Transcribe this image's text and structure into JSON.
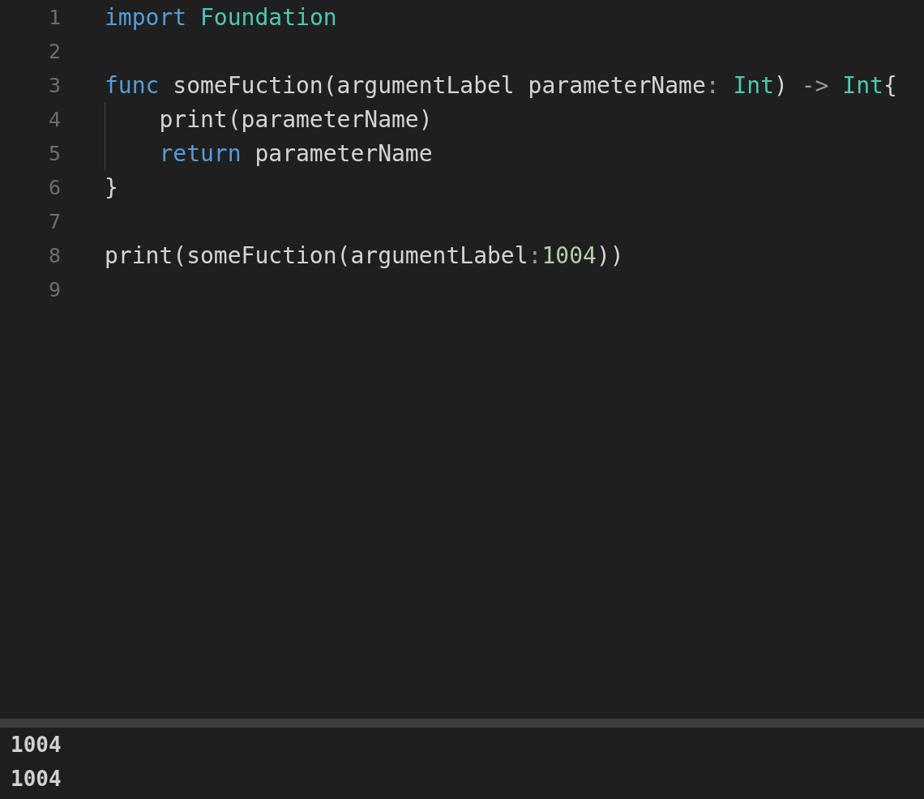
{
  "editor": {
    "lines": [
      {
        "number": "1",
        "indent_guide": false,
        "tokens": [
          {
            "text": "import ",
            "kind": "keyword"
          },
          {
            "text": "Foundation",
            "kind": "type"
          }
        ]
      },
      {
        "number": "2",
        "indent_guide": false
      },
      {
        "number": "3",
        "indent_guide": false,
        "tokens": [
          {
            "text": "func",
            "kind": "keyword"
          },
          {
            "text": " someFuction(argumentLabel parameterName",
            "kind": "plain"
          },
          {
            "text": ":",
            "kind": "operator"
          },
          {
            "text": " Int",
            "kind": "type"
          },
          {
            "text": ") ",
            "kind": "plain"
          },
          {
            "text": "->",
            "kind": "operator"
          },
          {
            "text": " Int",
            "kind": "type"
          },
          {
            "text": "{",
            "kind": "plain"
          }
        ]
      },
      {
        "number": "4",
        "indent_guide": true,
        "tokens": [
          {
            "text": "    print(parameterName)",
            "kind": "plain"
          }
        ]
      },
      {
        "number": "5",
        "indent_guide": true,
        "tokens": [
          {
            "text": "    return",
            "kind": "keyword"
          },
          {
            "text": " parameterName",
            "kind": "plain"
          }
        ]
      },
      {
        "number": "6",
        "indent_guide": false,
        "tokens": [
          {
            "text": "}",
            "kind": "plain"
          }
        ]
      },
      {
        "number": "7",
        "indent_guide": false
      },
      {
        "number": "8",
        "indent_guide": false,
        "tokens": [
          {
            "text": "print(someFuction(argumentLabel",
            "kind": "plain"
          },
          {
            "text": ":",
            "kind": "operator"
          },
          {
            "text": "1004",
            "kind": "number"
          },
          {
            "text": "))",
            "kind": "plain"
          }
        ]
      },
      {
        "number": "9",
        "indent_guide": false
      }
    ]
  },
  "output": {
    "lines": [
      "1004",
      "1004"
    ]
  }
}
